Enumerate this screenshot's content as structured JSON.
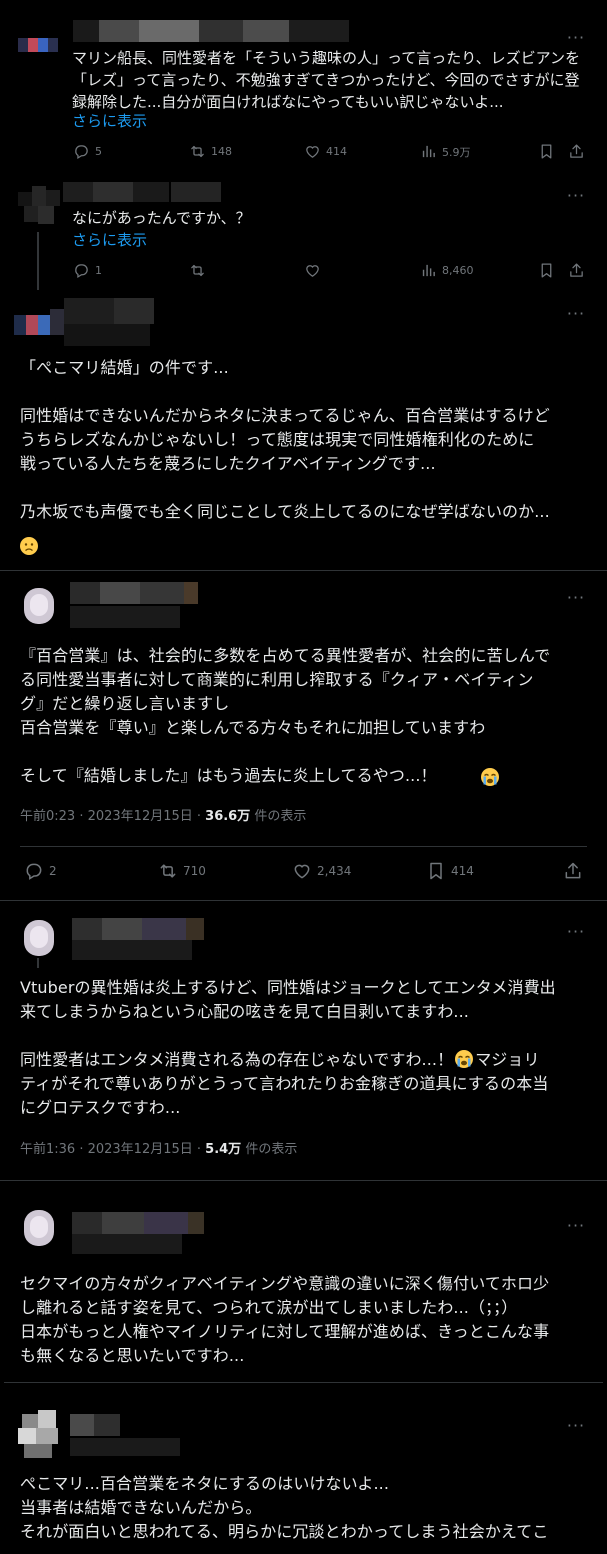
{
  "tweets": [
    {
      "text": "マリン船長、同性愛者を「そういう趣味の人」って言ったり、レズビアンを\n「レズ」って言ったり、不勉強すぎてきつかったけど、今回のでさすがに登\n録解除した...自分が面白ければなにやってもいい訳じゃないよ...",
      "show_more": "さらに表示",
      "reply_count": "5",
      "retweet_count": "148",
      "like_count": "414",
      "view_count": "5.9万"
    },
    {
      "text": "なにがあったんですか、？",
      "show_more": "さらに表示",
      "reply_count": "1",
      "view_count": "8,460"
    },
    {
      "text": "「ぺこマリ結婚」の件です...\n\n同性婚はできないんだからネタに決まってるじゃん、百合営業はするけど\nうちらレズなんかじゃないし！って態度は現実で同性婚権利化のために\n戦っている人たちを蔑ろにしたクイアベイティングです...\n\n乃木坂でも声優でも全く同じことして炎上してるのになぜ学ばないのか..."
    },
    {
      "text": "『百合営業』は、社会的に多数を占めてる異性愛者が、社会的に苦しんで\nる同性愛当事者に対して商業的に利用し搾取する『クィア・ベイティン\nグ』だと繰り返し言いますし\n百合営業を『尊い』と楽しんでる方々もそれに加担していますわ\n\nそして『結婚しました』はもう過去に炎上してるやつ...！",
      "time": "午前0:23 · 2023年12月15日 · ",
      "views": "36.6万",
      "views_label": " 件の表示",
      "reply_count": "2",
      "retweet_count": "710",
      "like_count": "2,434",
      "bookmark_count": "414"
    },
    {
      "text_1": "Vtuberの異性婚は炎上するけど、同性婚はジョークとしてエンタメ消費出\n来てしまうからねという心配の呟きを見て白目剥いてますわ...\n\n同性愛者はエンタメ消費される為の存在じゃないですわ...！",
      "text_2": "マジョリ\nティがそれで尊いありがとうって言われたりお金稼ぎの道具にするの本当\nにグロテスクですわ...",
      "time": "午前1:36 · 2023年12月15日 · ",
      "views": "5.4万",
      "views_label": " 件の表示"
    },
    {
      "text": "セクマイの方々がクィアベイティングや意識の違いに深く傷付いてホロ少\nし離れると話す姿を見て、つられて涙が出てしまいましたわ...（；；）\n日本がもっと人権やマイノリティに対して理解が進めば、きっとこんな事\nも無くなると思いたいですわ..."
    },
    {
      "text": "ぺこマリ...百合営業をネタにするのはいけないよ...\n当事者は結婚できないんだから。\nそれが面白いと思われてる、明らかに冗談とわかってしまう社会かえてこ"
    }
  ],
  "more_glyph": "···",
  "icons": [
    "reply-icon",
    "retweet-icon",
    "like-icon",
    "views-icon",
    "bookmark-icon",
    "share-icon",
    "more-icon",
    "sad-face-emoji",
    "crying-face-emoji"
  ],
  "colors": {
    "background": "#000000",
    "text": "#e7e9ea",
    "muted": "#71767b",
    "link": "#1d9bf0",
    "border": "#2f3336"
  }
}
